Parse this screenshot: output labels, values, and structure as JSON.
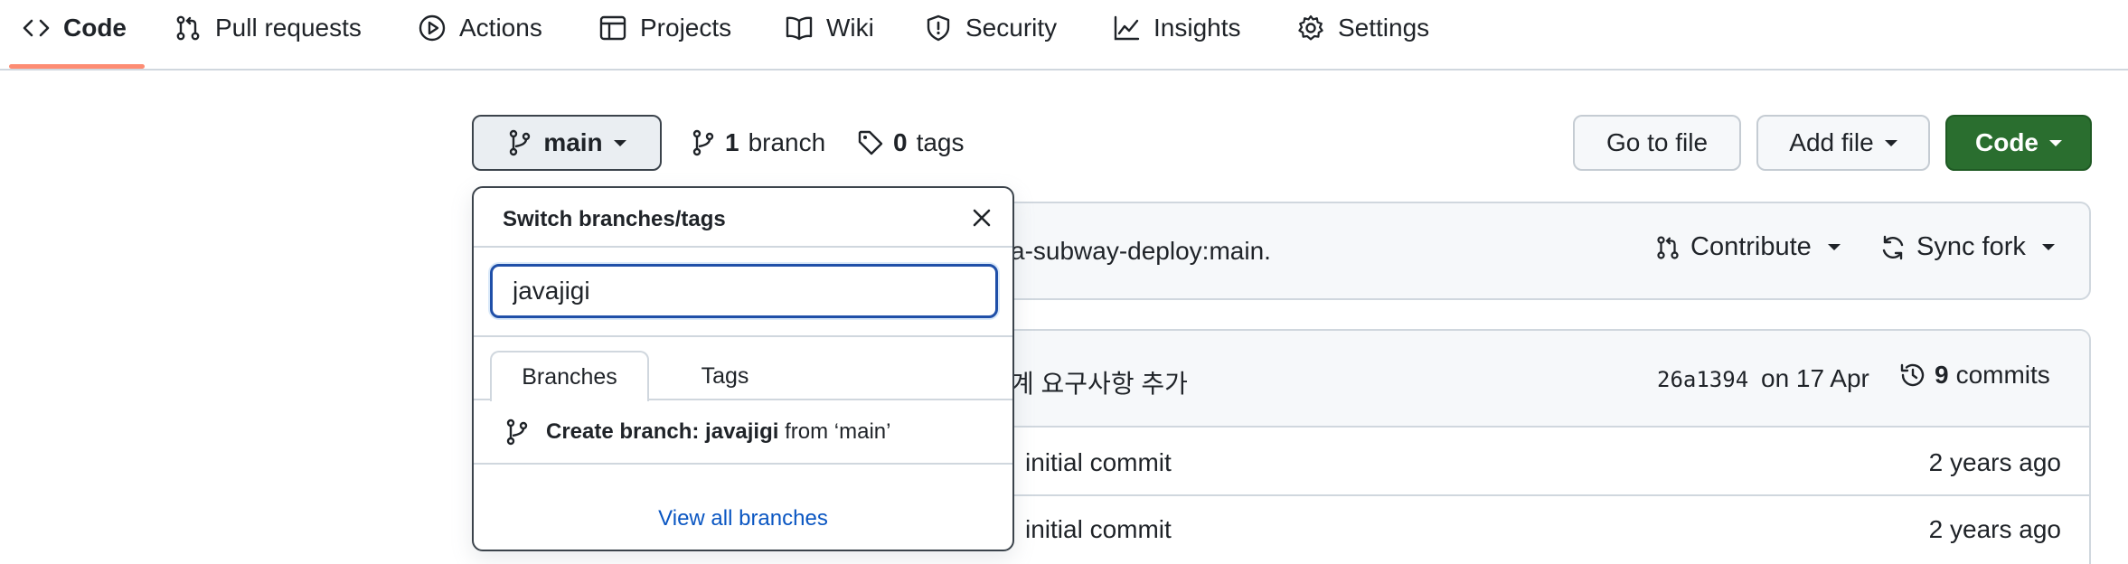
{
  "nav": {
    "tabs": [
      {
        "label": "Code",
        "icon": "code-icon",
        "selected": true
      },
      {
        "label": "Pull requests",
        "icon": "git-pull-request-icon"
      },
      {
        "label": "Actions",
        "icon": "play-icon"
      },
      {
        "label": "Projects",
        "icon": "table-icon"
      },
      {
        "label": "Wiki",
        "icon": "book-icon"
      },
      {
        "label": "Security",
        "icon": "shield-icon"
      },
      {
        "label": "Insights",
        "icon": "graph-icon"
      },
      {
        "label": "Settings",
        "icon": "gear-icon"
      }
    ]
  },
  "toolbar": {
    "branch_label": "main",
    "branch_count": "1",
    "branch_word": "branch",
    "tag_count": "0",
    "tag_word": "tags",
    "go_to_file": "Go to file",
    "add_file": "Add file",
    "code": "Code"
  },
  "fork_banner": {
    "text": "a-subway-deploy:main.",
    "contribute": "Contribute",
    "sync_fork": "Sync fork"
  },
  "latest_commit": {
    "message": "계 요구사항 추가",
    "sha": "26a1394",
    "date": "on 17 Apr",
    "commit_count": "9",
    "commit_word": "commits"
  },
  "files": [
    {
      "message": "initial commit",
      "age": "2 years ago"
    },
    {
      "message": "initial commit",
      "age": "2 years ago"
    }
  ],
  "branch_dropdown": {
    "title": "Switch branches/tags",
    "search_value": "javajigi",
    "tab_branches": "Branches",
    "tab_tags": "Tags",
    "create_prefix": "Create branch: javajigi",
    "create_suffix": "from ‘main’",
    "view_all": "View all branches"
  },
  "colors": {
    "accent_underline": "#fd8c73",
    "code_button": "#2a6e2f",
    "link": "#0a56c2",
    "focus_border": "#1f4fa8"
  }
}
